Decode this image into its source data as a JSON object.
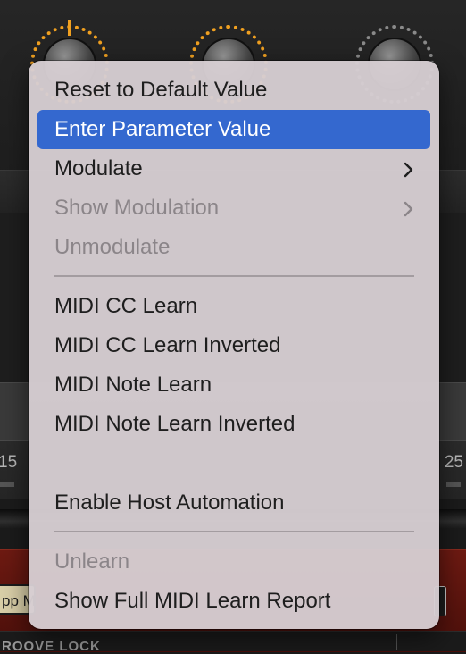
{
  "background": {
    "left_value": "15",
    "right_value": "25",
    "red_box_text": "pp M",
    "bottom_label": "ROOVE LOCK"
  },
  "menu": {
    "items": [
      {
        "label": "Reset to Default Value",
        "enabled": true
      },
      {
        "label": "Enter Parameter Value",
        "enabled": true,
        "selected": true
      },
      {
        "label": "Modulate",
        "enabled": true,
        "submenu": true
      },
      {
        "label": "Show Modulation",
        "enabled": false,
        "submenu": true
      },
      {
        "label": "Unmodulate",
        "enabled": false
      },
      {
        "label": "MIDI CC Learn",
        "enabled": true
      },
      {
        "label": "MIDI CC Learn Inverted",
        "enabled": true
      },
      {
        "label": "MIDI Note Learn",
        "enabled": true
      },
      {
        "label": "MIDI Note Learn Inverted",
        "enabled": true
      },
      {
        "label": "Enable Host Automation",
        "enabled": true
      },
      {
        "label": "Unlearn",
        "enabled": false
      },
      {
        "label": "Show Full MIDI Learn Report",
        "enabled": true
      }
    ]
  },
  "colors": {
    "menu_background": "#d6ced2",
    "highlight": "#3468cf",
    "text": "#1e1e1e",
    "disabled_text": "#8b8589",
    "knob_accent": "#f0a020"
  }
}
